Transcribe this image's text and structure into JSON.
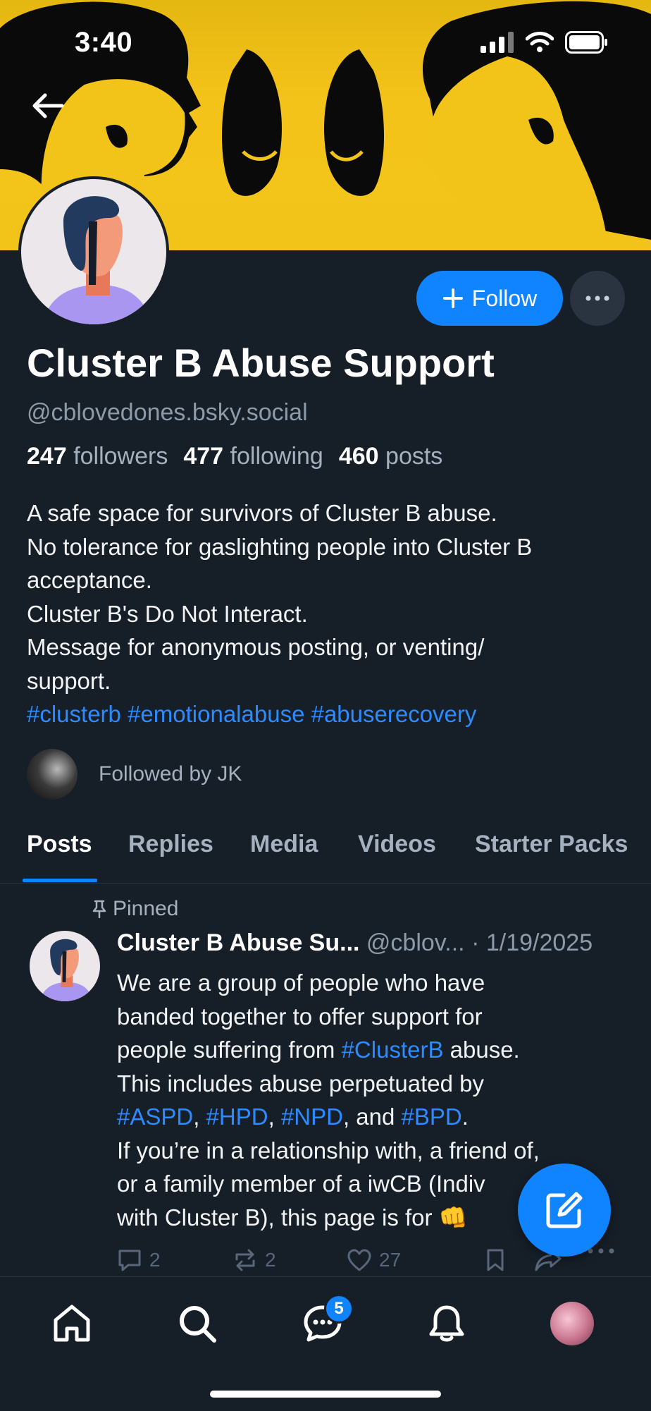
{
  "status_bar": {
    "time": "3:40"
  },
  "header": {
    "back_icon": "arrow-left-icon"
  },
  "profile": {
    "display_name": "Cluster B Abuse Support",
    "handle": "@cblovedones.bsky.social",
    "followers_count": "247",
    "followers_label": "followers",
    "following_count": "477",
    "following_label": "following",
    "posts_count": "460",
    "posts_label": "posts",
    "follow_label": "Follow",
    "bio_lines": [
      "A safe space for survivors of Cluster B abuse.",
      "No tolerance for gaslighting people into Cluster B",
      "acceptance.",
      "Cluster B's Do Not Interact.",
      "Message for anonymous posting, or venting/",
      "support."
    ],
    "bio_tags": "#clusterb #emotionalabuse #abuserecovery",
    "followed_by": "Followed by JK"
  },
  "tabs": [
    "Posts",
    "Replies",
    "Media",
    "Videos",
    "Starter Packs"
  ],
  "pinned_post": {
    "pinned_label": "Pinned",
    "author": "Cluster B Abuse Su...",
    "handle": "@cblov...",
    "date": "· 1/19/2025",
    "body": {
      "l1": "We are a group of people who have",
      "l2": "banded together to offer support for",
      "l3a": "people suffering from ",
      "l3tag": "#ClusterB",
      "l3b": " abuse.",
      "l4": "This includes abuse perpetuated by",
      "t1": "#ASPD",
      "s1": ", ",
      "t2": "#HPD",
      "s2": ", ",
      "t3": "#NPD",
      "s3": ", and ",
      "t4": "#BPD",
      "s4": ".",
      "l6": "If you’re in a relationship with, a friend of,",
      "l7": "or a family member of a iwCB (Indiv",
      "l8": "with Cluster B), this page is for 👊"
    },
    "replies": "2",
    "reposts": "2",
    "likes": "27"
  },
  "bottom_nav": {
    "messages_badge": "5"
  },
  "colors": {
    "accent": "#1083fe",
    "background": "#161e27",
    "banner": "#f2c419",
    "link": "#2c8bff"
  }
}
